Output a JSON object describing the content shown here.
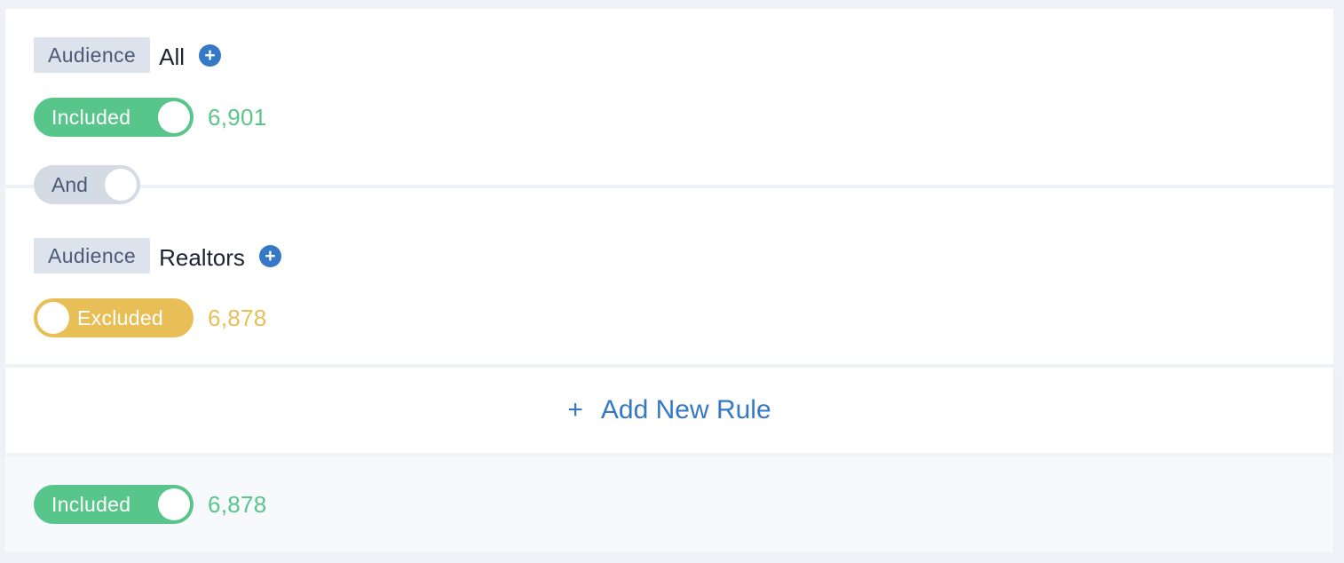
{
  "rules": [
    {
      "audience_label": "Audience",
      "audience_name": "All",
      "add_icon": "plus-circle-icon",
      "status_label": "Included",
      "status": "included",
      "count": "6,901"
    },
    {
      "audience_label": "Audience",
      "audience_name": "Realtors",
      "add_icon": "plus-circle-icon",
      "status_label": "Excluded",
      "status": "excluded",
      "count": "6,878"
    }
  ],
  "connector": {
    "label": "And"
  },
  "add_rule": {
    "icon": "+",
    "label": "Add New Rule"
  },
  "summary": {
    "status_label": "Included",
    "count": "6,878"
  },
  "colors": {
    "included": "#58c68a",
    "excluded": "#e8bf56",
    "accent": "#3478c6",
    "badge_bg": "#dde3ec",
    "badge_text": "#4a5a78"
  }
}
